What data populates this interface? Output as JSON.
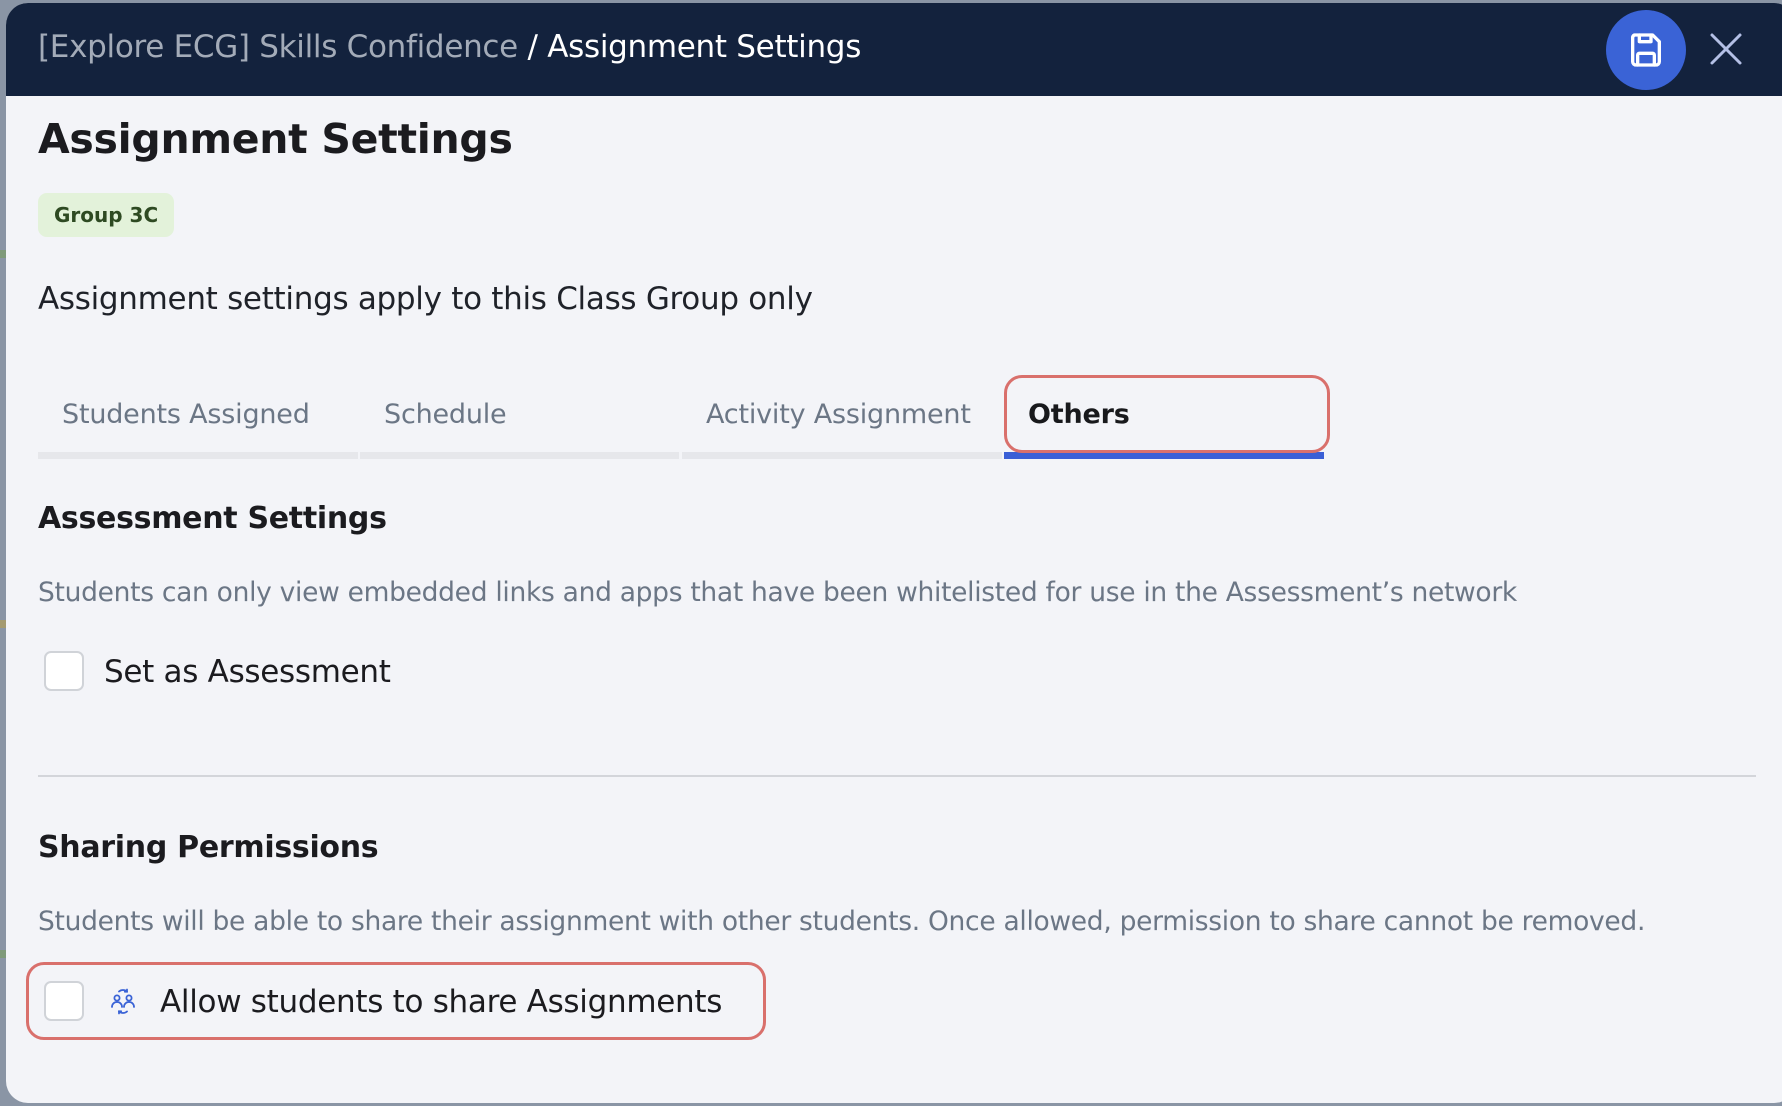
{
  "header": {
    "breadcrumb_parent": "[Explore ECG] Skills Confidence",
    "breadcrumb_separator": " / ",
    "breadcrumb_current": "Assignment Settings",
    "save_icon": "floppy-disk-icon",
    "close_icon": "close-x-icon"
  },
  "page": {
    "title": "Assignment Settings",
    "group_badge": "Group 3C",
    "subtitle": "Assignment settings apply to this Class Group only"
  },
  "tabs": [
    {
      "label": "Students Assigned",
      "active": false
    },
    {
      "label": "Schedule",
      "active": false
    },
    {
      "label": "Activity Assignment",
      "active": false
    },
    {
      "label": "Others",
      "active": true
    }
  ],
  "assessment": {
    "heading": "Assessment Settings",
    "description": "Students can only view embedded links and apps that have been whitelisted for use in the Assessment’s network",
    "checkbox_label": "Set as Assessment",
    "checked": false
  },
  "sharing": {
    "heading": "Sharing Permissions",
    "description": "Students will be able to share their assignment with other students. Once allowed, permission to share cannot be removed.",
    "checkbox_label": "Allow students to share Assignments",
    "checked": false,
    "icon": "share-students-icon"
  },
  "colors": {
    "header_bg": "#13223d",
    "accent": "#3a63d6",
    "highlight": "#d9706c",
    "badge_bg": "#e3f2da",
    "badge_text": "#2e4a22"
  }
}
